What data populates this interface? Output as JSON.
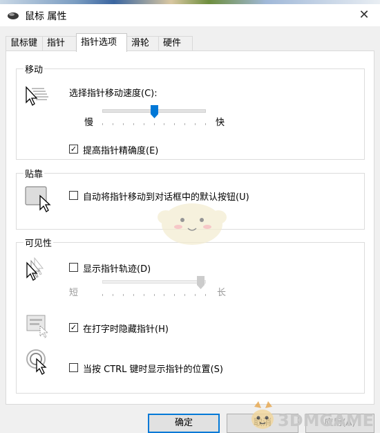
{
  "window": {
    "title": "鼠标 属性",
    "close_glyph": "✕"
  },
  "tabs": [
    {
      "label": "鼠标键"
    },
    {
      "label": "指针"
    },
    {
      "label": "指针选项"
    },
    {
      "label": "滑轮"
    },
    {
      "label": "硬件"
    }
  ],
  "active_tab": "指针选项",
  "motion": {
    "title": "移动",
    "speed_label": "选择指针移动速度(C):",
    "slow_label": "慢",
    "fast_label": "快",
    "speed_value_fraction": 0.5,
    "precision_label": "提高指针精确度(E)",
    "precision_checked": true
  },
  "snap": {
    "title": "贴靠",
    "snap_label": "自动将指针移动到对话框中的默认按钮(U)",
    "snap_checked": false
  },
  "visibility": {
    "title": "可见性",
    "trails_label": "显示指针轨迹(D)",
    "trails_checked": false,
    "short_label": "短",
    "long_label": "长",
    "trails_value_fraction": 0.95,
    "hide_label": "在打字时隐藏指针(H)",
    "hide_checked": true,
    "ctrl_label": "当按 CTRL 键时显示指针的位置(S)",
    "ctrl_checked": false
  },
  "buttons": {
    "ok": "确定",
    "cancel": "取消",
    "apply": "应用(A)"
  },
  "watermark": {
    "text": "3DMGAME"
  },
  "colors": {
    "accent": "#0078d7",
    "panel_bg": "#ffffff",
    "window_bg": "#f0f0f0"
  }
}
